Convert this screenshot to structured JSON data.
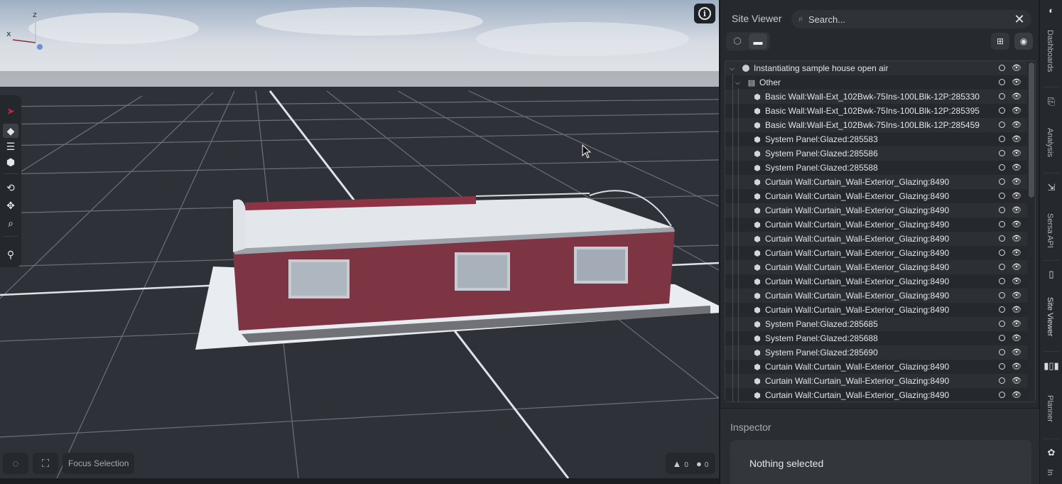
{
  "viewport": {
    "axis_labels": {
      "x": "x",
      "z": "z"
    },
    "toolbar_icons": [
      "pointer-icon",
      "surface-icon",
      "layers-icon",
      "cube-icon",
      "orbit-icon",
      "move-icon",
      "zoom-icon",
      "measure-icon"
    ],
    "bottom": {
      "hide_icon": "eye-off-icon",
      "focus_icon": "focus-frame-icon",
      "focus_label": "Focus Selection"
    },
    "status": {
      "warnings": "0",
      "errors": "0"
    }
  },
  "site_viewer": {
    "title": "Site Viewer",
    "search": {
      "placeholder": "Search...",
      "value": ""
    },
    "tree": {
      "root": "Instantiating sample house open air",
      "group": "Other",
      "items": [
        "Basic Wall:Wall-Ext_102Bwk-75Ins-100LBlk-12P:285330",
        "Basic Wall:Wall-Ext_102Bwk-75Ins-100LBlk-12P:285395",
        "Basic Wall:Wall-Ext_102Bwk-75Ins-100LBlk-12P:285459",
        "System Panel:Glazed:285583",
        "System Panel:Glazed:285586",
        "System Panel:Glazed:285588",
        "Curtain Wall:Curtain_Wall-Exterior_Glazing:8490",
        "Curtain Wall:Curtain_Wall-Exterior_Glazing:8490",
        "Curtain Wall:Curtain_Wall-Exterior_Glazing:8490",
        "Curtain Wall:Curtain_Wall-Exterior_Glazing:8490",
        "Curtain Wall:Curtain_Wall-Exterior_Glazing:8490",
        "Curtain Wall:Curtain_Wall-Exterior_Glazing:8490",
        "Curtain Wall:Curtain_Wall-Exterior_Glazing:8490",
        "Curtain Wall:Curtain_Wall-Exterior_Glazing:8490",
        "Curtain Wall:Curtain_Wall-Exterior_Glazing:8490",
        "Curtain Wall:Curtain_Wall-Exterior_Glazing:8490",
        "System Panel:Glazed:285685",
        "System Panel:Glazed:285688",
        "System Panel:Glazed:285690",
        "Curtain Wall:Curtain_Wall-Exterior_Glazing:8490",
        "Curtain Wall:Curtain_Wall-Exterior_Glazing:8490",
        "Curtain Wall:Curtain_Wall-Exterior_Glazing:8490"
      ]
    }
  },
  "inspector": {
    "title": "Inspector",
    "empty_text": "Nothing selected"
  },
  "rail": {
    "labels": [
      "Dashboards",
      "Analysis",
      "Sersa API",
      "Site Viewer",
      "Planner",
      "In"
    ],
    "icons": [
      "dashboards-icon",
      "analysis-icon",
      "api-icon",
      "site-viewer-icon",
      "planner-icon",
      "integrations-icon"
    ]
  },
  "colors": {
    "house_wall": "#7e3543",
    "roof": "#e3e6ea",
    "panel_bg": "#26292e"
  }
}
